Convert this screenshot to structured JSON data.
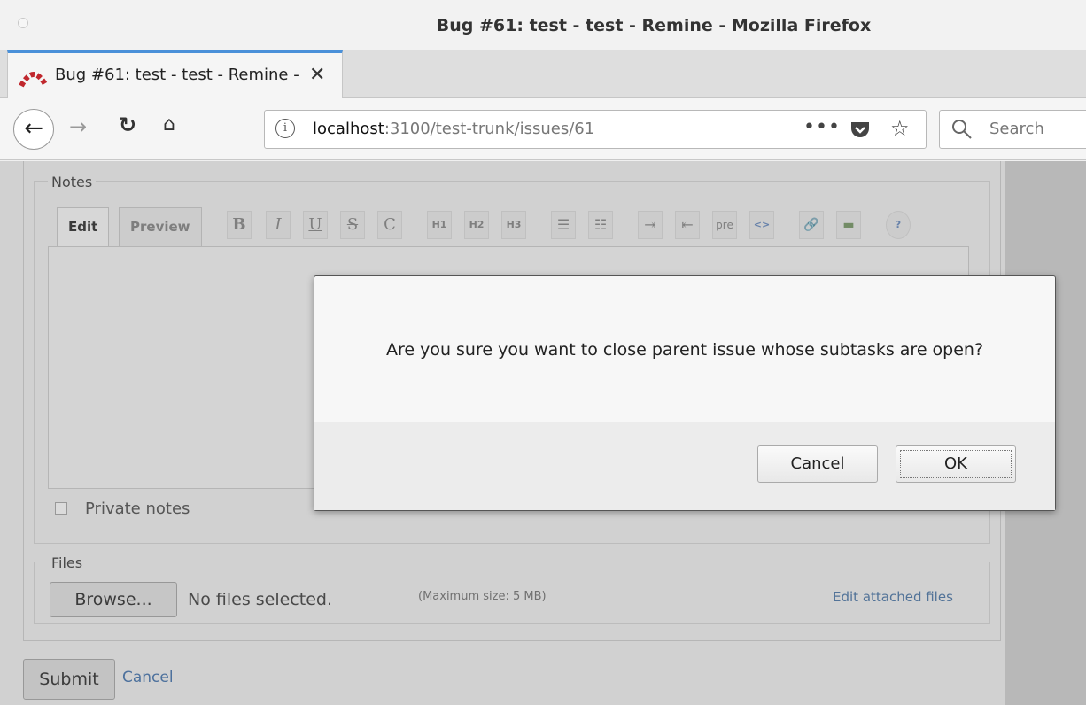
{
  "window": {
    "title": "Bug #61: test - test - Remine - Mozilla Firefox"
  },
  "tab": {
    "label": "Bug #61: test - test - Remine - Mozilla Firefox",
    "close_glyph": "✕"
  },
  "nav": {
    "url_host": "localhost",
    "url_rest": ":3100/test-trunk/issues/61",
    "more_glyph": "•••",
    "search_placeholder": "Search"
  },
  "notes": {
    "legend": "Notes",
    "tabs": [
      {
        "label": "Edit",
        "active": true
      },
      {
        "label": "Preview",
        "active": false
      }
    ],
    "toolbar": [
      {
        "name": "bold",
        "glyph": "B"
      },
      {
        "name": "italic",
        "glyph": "I"
      },
      {
        "name": "underline",
        "glyph": "U"
      },
      {
        "name": "strikethrough",
        "glyph": "S"
      },
      {
        "name": "code",
        "glyph": "C"
      },
      {
        "name": "h1",
        "glyph": "H1"
      },
      {
        "name": "h2",
        "glyph": "H2"
      },
      {
        "name": "h3",
        "glyph": "H3"
      },
      {
        "name": "unordered-list",
        "glyph": "☰"
      },
      {
        "name": "ordered-list",
        "glyph": "☷"
      },
      {
        "name": "indent",
        "glyph": "⇥"
      },
      {
        "name": "outdent",
        "glyph": "⇤"
      },
      {
        "name": "pre",
        "glyph": "pre"
      },
      {
        "name": "inline-code",
        "glyph": "<>"
      },
      {
        "name": "link",
        "glyph": "🔗"
      },
      {
        "name": "image",
        "glyph": "▬"
      },
      {
        "name": "help",
        "glyph": "?"
      }
    ],
    "private_label": "Private notes"
  },
  "files": {
    "legend": "Files",
    "browse_label": "Browse...",
    "status": "No files selected.",
    "max_size": "(Maximum size: 5 MB)",
    "edit_link": "Edit attached files"
  },
  "form": {
    "submit_label": "Submit",
    "cancel_label": "Cancel"
  },
  "dialog": {
    "message": "Are you sure you want to close parent issue whose subtasks are open?",
    "cancel_label": "Cancel",
    "ok_label": "OK"
  },
  "colors": {
    "tab_accent": "#4a90d9",
    "link": "#4a78b0",
    "redmine_logo": "#c0272d"
  }
}
